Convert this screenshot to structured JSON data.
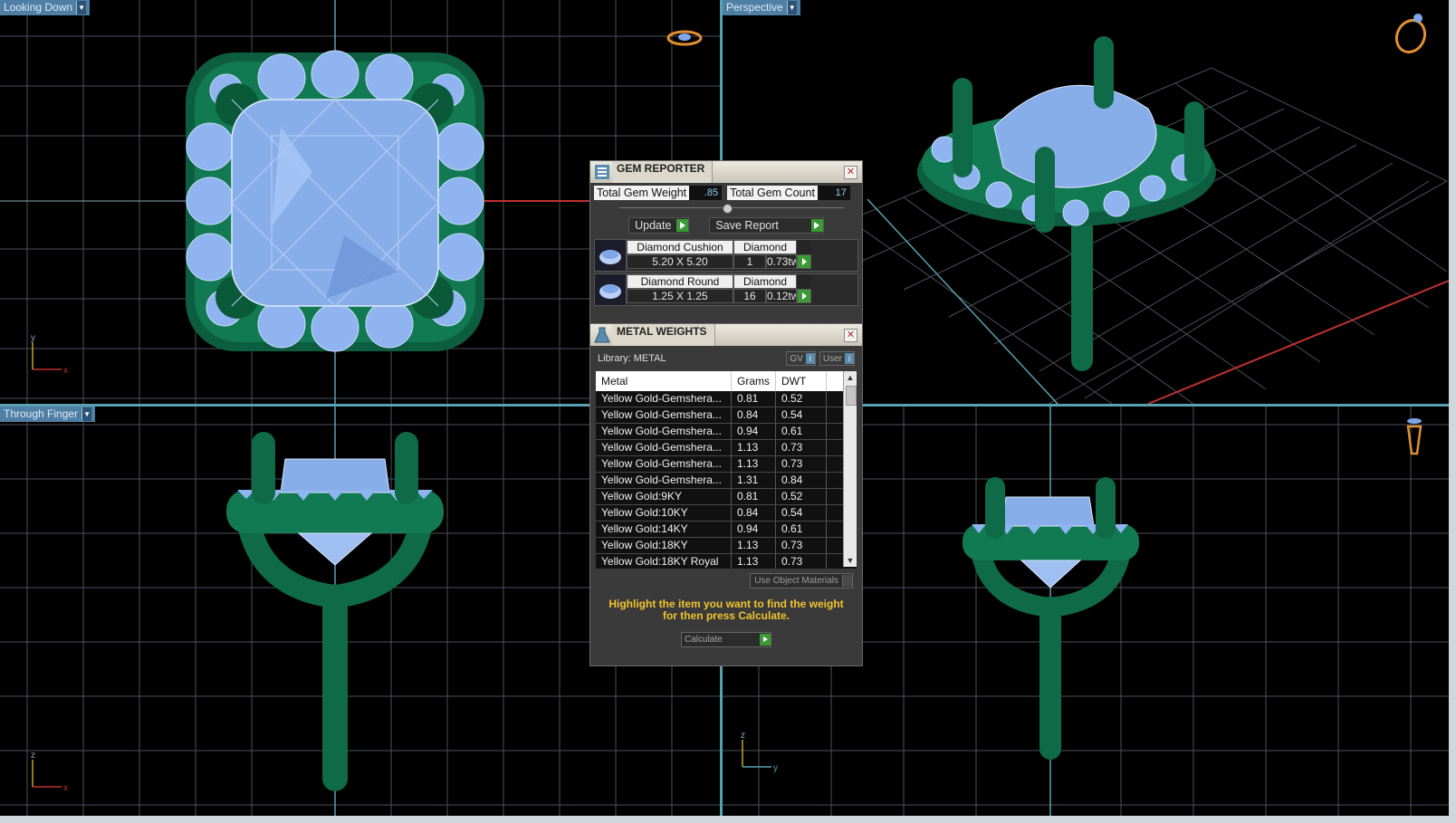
{
  "viewports": {
    "top_left": {
      "label": "Looking Down",
      "axis_v": "y",
      "axis_h": "x"
    },
    "top_right": {
      "label": "Perspective"
    },
    "bottom_left": {
      "label": "Through Finger",
      "axis_v": "z",
      "axis_h": "x"
    },
    "bottom_right": {
      "axis_v": "z",
      "axis_h": "y"
    }
  },
  "icons": {
    "top_left_corner": "ring-top-icon",
    "top_right_corner": "ring-perspective-icon",
    "bottom_right_corner": "ring-side-icon"
  },
  "gem_reporter": {
    "title": "GEM REPORTER",
    "total_weight_label": "Total Gem Weight",
    "total_weight_value": ".85",
    "total_count_label": "Total Gem Count",
    "total_count_value": "17",
    "update_label": "Update",
    "save_label": "Save Report",
    "gems": [
      {
        "name": "Diamond Cushion",
        "type": "Diamond",
        "size": "5.20 X 5.20",
        "count": "1",
        "weight": "0.73tw"
      },
      {
        "name": "Diamond Round",
        "type": "Diamond",
        "size": "1.25 X 1.25",
        "count": "16",
        "weight": "0.12tw"
      }
    ]
  },
  "metal_weights": {
    "title": "METAL WEIGHTS",
    "library_label": "Library: METAL",
    "gv_label": "GV",
    "user_label": "User",
    "columns": [
      "Metal",
      "Grams",
      "DWT"
    ],
    "rows": [
      [
        "Yellow Gold-Gemshera...",
        "0.81",
        "0.52"
      ],
      [
        "Yellow Gold-Gemshera...",
        "0.84",
        "0.54"
      ],
      [
        "Yellow Gold-Gemshera...",
        "0.94",
        "0.61"
      ],
      [
        "Yellow Gold-Gemshera...",
        "1.13",
        "0.73"
      ],
      [
        "Yellow Gold-Gemshera...",
        "1.13",
        "0.73"
      ],
      [
        "Yellow Gold-Gemshera...",
        "1.31",
        "0.84"
      ],
      [
        "Yellow Gold:9KY",
        "0.81",
        "0.52"
      ],
      [
        "Yellow Gold:10KY",
        "0.84",
        "0.54"
      ],
      [
        "Yellow Gold:14KY",
        "0.94",
        "0.61"
      ],
      [
        "Yellow Gold:18KY",
        "1.13",
        "0.73"
      ],
      [
        "Yellow Gold:18KY Royal",
        "1.13",
        "0.73"
      ]
    ],
    "use_object_label": "Use Object Materials",
    "hint_line1": "Highlight the item you want to find the weight",
    "hint_line2": "for then press Calculate.",
    "calculate_label": "Calculate"
  },
  "colors": {
    "grid": "#4a4f58",
    "metal": "#0f6a48",
    "gem": "#8ab0ee",
    "accent_line": "#58a0b4",
    "label_bg": "#4f7fa4",
    "hint": "#f2c42e"
  }
}
